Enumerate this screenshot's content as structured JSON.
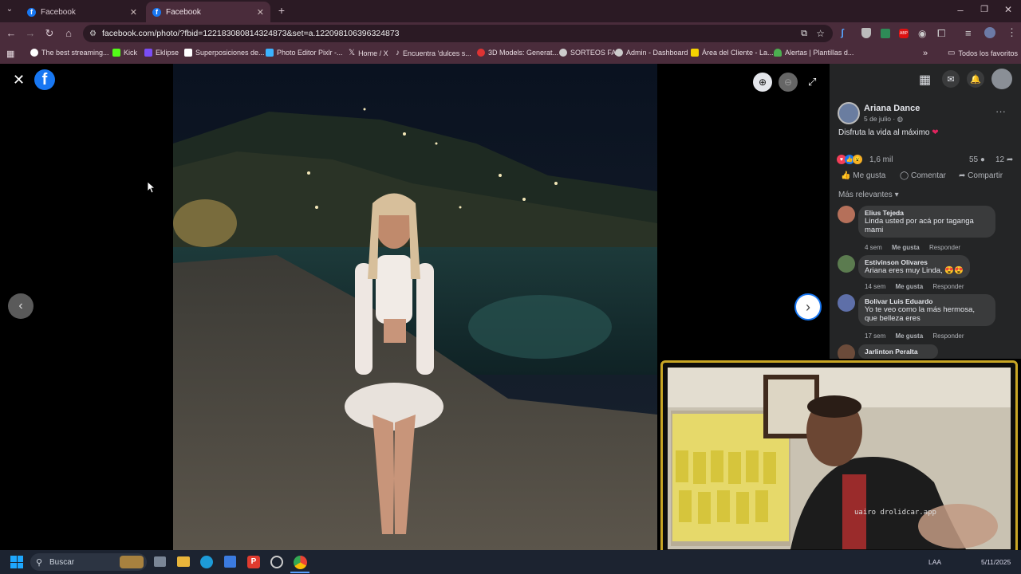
{
  "browser": {
    "tabs": [
      {
        "title": "Facebook",
        "active": false
      },
      {
        "title": "Facebook",
        "active": true
      }
    ],
    "url": "facebook.com/photo/?fbid=122183080814324873&set=a.122098106396324873",
    "bookmarks": [
      "The best streaming...",
      "Kick",
      "Eklipse",
      "Superposiciones de...",
      "Photo Editor Pixlr -...",
      "Home / X",
      "Encuentra 'dulces s...",
      "3D Models: Generat...",
      "SORTEOS FA",
      "Admin - Dashboard",
      "Área del Cliente - La...",
      "Alertas | Plantillas d..."
    ],
    "all_favorites": "Todos los favoritos",
    "window_controls": [
      "minimize",
      "restore",
      "close"
    ]
  },
  "post": {
    "author": "Ariana Dance",
    "date": "5 de julio ·",
    "caption": "Disfruta la vida al máximo",
    "reactions_count": "1,6 mil",
    "comments_count": "55",
    "shares_count": "12",
    "actions": {
      "like": "Me gusta",
      "comment": "Comentar",
      "share": "Compartir"
    },
    "sort_label": "Más relevantes"
  },
  "comments": [
    {
      "name": "Elius Tejeda",
      "text": "Linda usted por acá por taganga mami",
      "time": "4 sem",
      "like": "Me gusta",
      "reply": "Responder"
    },
    {
      "name": "Estivinson Olivares",
      "text": "Ariana eres muy Linda, 😍😍",
      "time": "14 sem",
      "like": "Me gusta",
      "reply": "Responder"
    },
    {
      "name": "Bolivar Luis Eduardo",
      "text": "Yo te veo como la más hermosa, que belleza eres",
      "time": "17 sem",
      "like": "Me gusta",
      "reply": "Responder"
    },
    {
      "name": "Jarlinton Peralta",
      "text": "",
      "time": "",
      "like": "",
      "reply": ""
    }
  ],
  "taskbar": {
    "search_placeholder": "Buscar",
    "lang": "LAA",
    "date": "5/11/2025"
  },
  "webcam_overlay": {
    "shirt_text": "uairo drolidcar.app"
  },
  "colors": {
    "browser_frame": "#4a2c3b",
    "browser_tabs": "#2b1a24",
    "facebook_blue": "#1877f2",
    "panel_bg": "#242526",
    "bubble_bg": "#3a3b3c",
    "webcam_border": "#c8a625"
  }
}
